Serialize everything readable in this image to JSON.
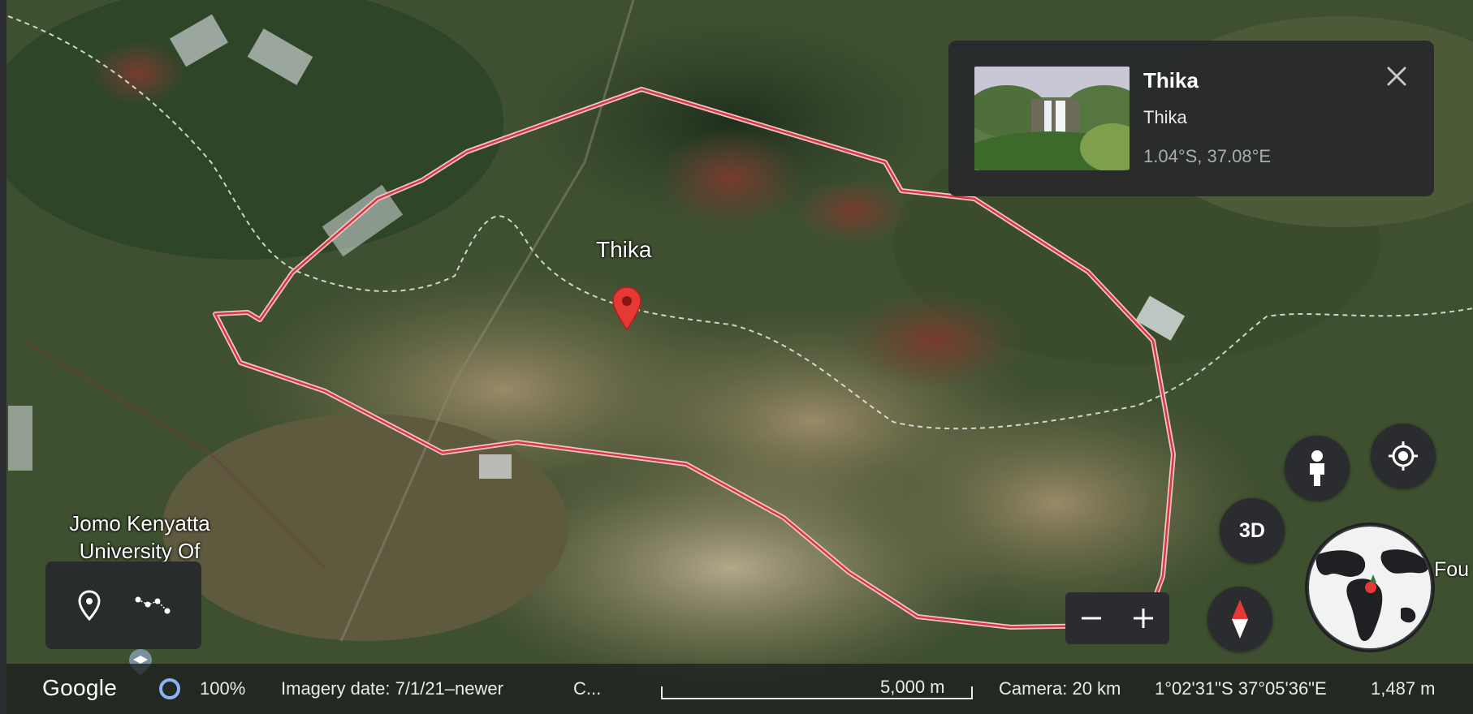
{
  "map": {
    "place_label": "Thika",
    "poi_label_line1": "Jomo Kenyatta",
    "poi_label_line2": "University Of",
    "globe_label": "Fou"
  },
  "info_card": {
    "title": "Thika",
    "subtitle": "Thika",
    "coordinates": "1.04°S, 37.08°E"
  },
  "controls": {
    "btn_3d_label": "3D",
    "zoom_out_icon": "minus-icon",
    "zoom_in_icon": "plus-icon",
    "pegman_icon": "person-icon",
    "locate_icon": "my-location-icon",
    "compass_icon": "compass-icon",
    "tools": [
      "place-pin-icon",
      "draw-path-icon"
    ]
  },
  "status_bar": {
    "logo": "Google",
    "progress_percent": "100%",
    "imagery_date": "Imagery date: 7/1/21–newer",
    "credits": "C...",
    "scale": "5,000 m",
    "camera": "Camera: 20 km",
    "cursor_coords": "1°02'31\"S 37°05'36\"E",
    "elevation": "1,487 m"
  },
  "colors": {
    "boundary": "#e53a4a",
    "panel": "#28292c",
    "pin": "#e53935"
  }
}
